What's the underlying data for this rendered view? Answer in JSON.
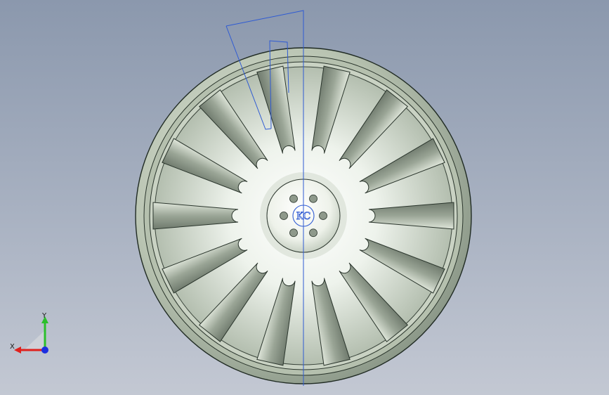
{
  "viewport": {
    "background_top": "#8b98ad",
    "background_bottom": "#c3c8d3"
  },
  "model": {
    "part": "wheel-rim",
    "spoke_count": 14,
    "bolt_hole_count": 6,
    "logo_text": "KC",
    "rim_color": "#c9d2c3",
    "spoke_color": "#eef2ea",
    "sketch_color": "#2f5bd3"
  },
  "triad": {
    "x_label": "X",
    "y_label": "Y",
    "x_color": "#e0201c",
    "y_color": "#2bbf2b",
    "z_color": "#1c2ee0"
  }
}
